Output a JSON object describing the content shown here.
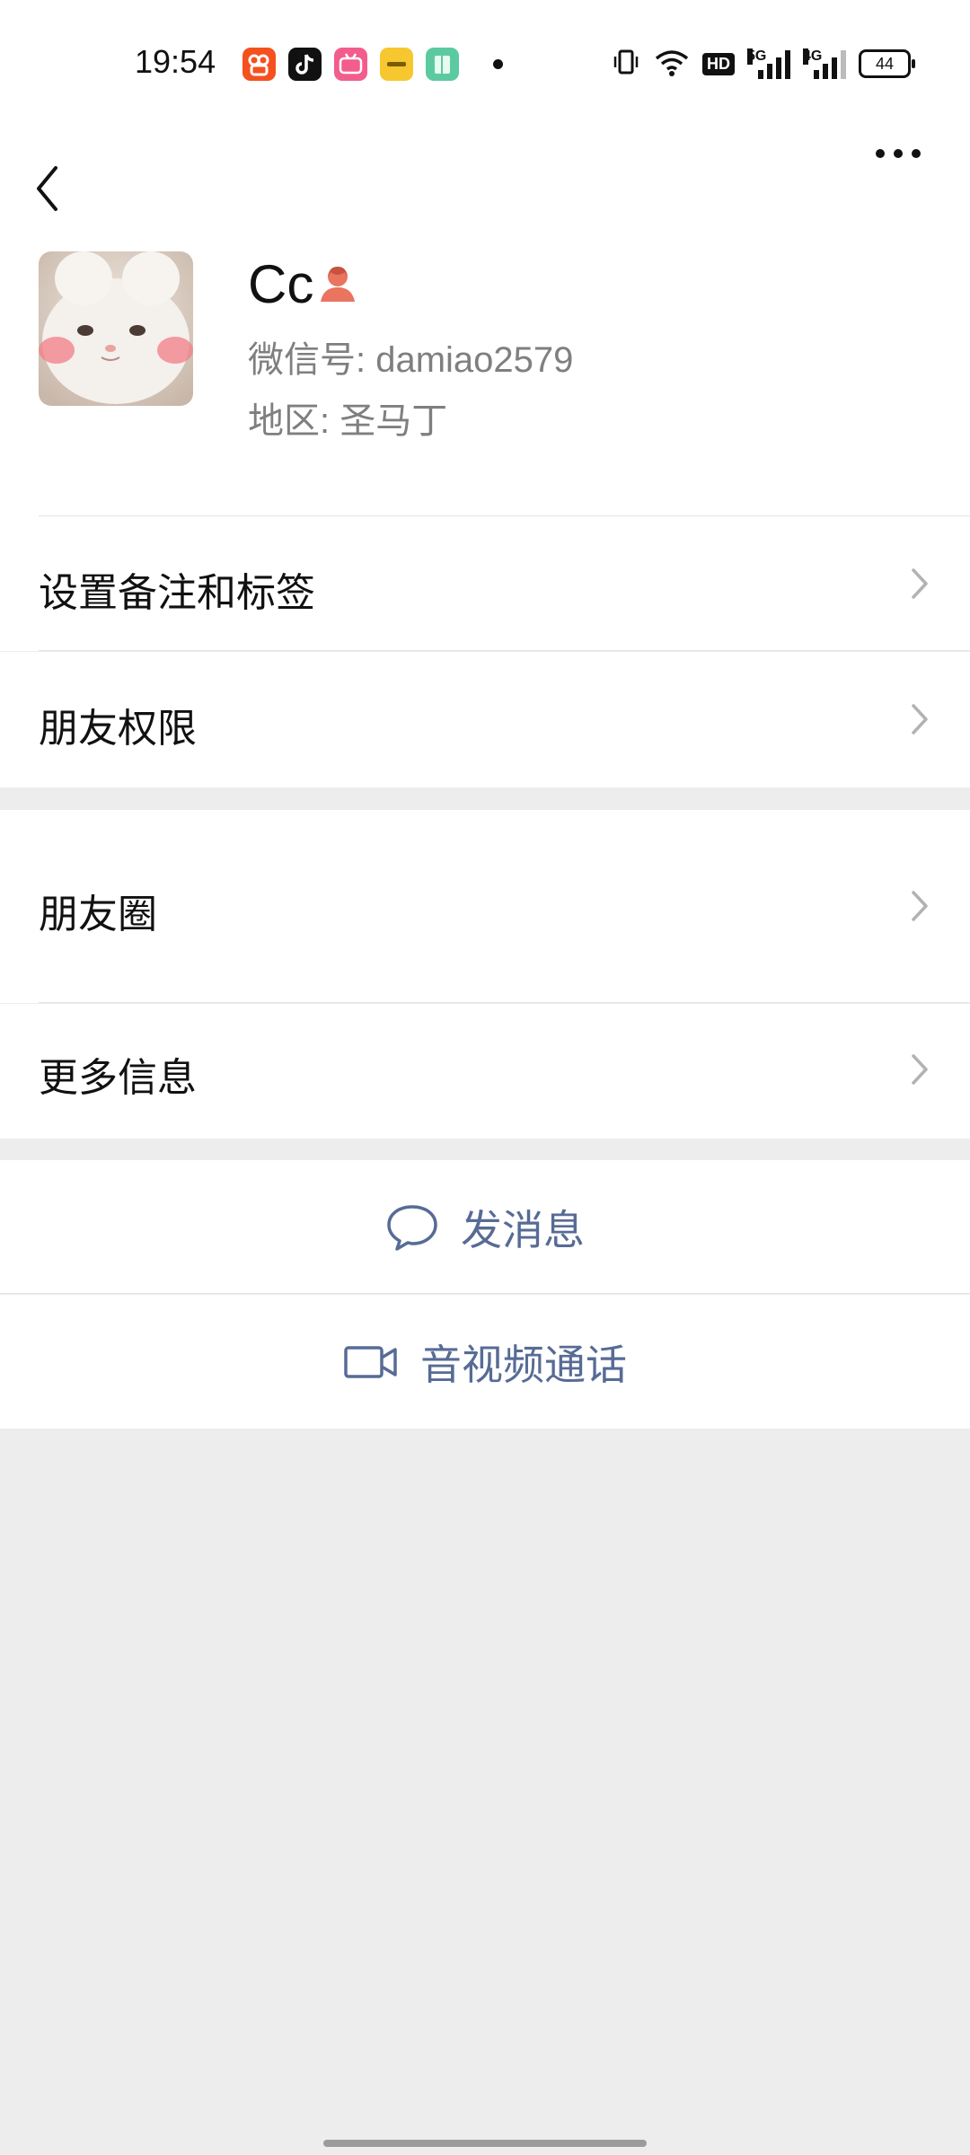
{
  "status_bar": {
    "time": "19:54",
    "network_1": "5G",
    "network_2": "4G",
    "hd_label": "HD",
    "battery": "44",
    "app_icons": [
      "kuaishou-app-icon",
      "douyin-app-icon",
      "bilibili-app-icon",
      "realme-app-icon",
      "notes-app-icon"
    ]
  },
  "profile": {
    "name": "Cc",
    "wechat_id": "微信号:  damiao2579",
    "region": "地区:  圣马丁",
    "gender_icon": "female-icon",
    "gender_color": "#e9745f"
  },
  "rows": {
    "remark_tags": "设置备注和标签",
    "friend_permissions": "朋友权限",
    "moments": "朋友圈",
    "more_info": "更多信息"
  },
  "actions": {
    "send_message": "发消息",
    "video_call": "音视频通话"
  },
  "colors": {
    "link": "#576b95",
    "background": "#ededed",
    "divider": "#e5e5e5"
  }
}
